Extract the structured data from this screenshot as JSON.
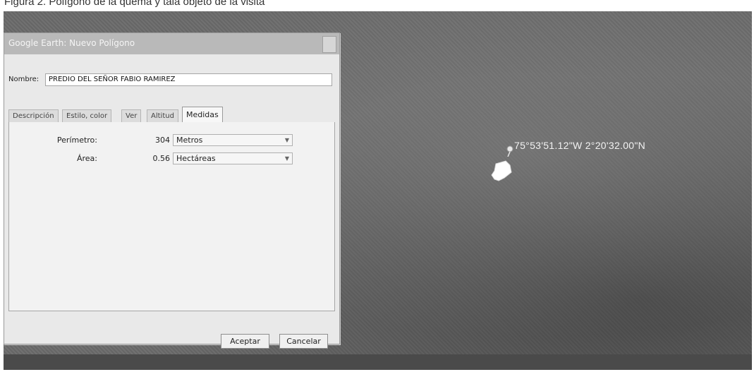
{
  "caption": "Figura 2. Polígono de la quema y tala objeto de la visita",
  "map": {
    "coordinates": "75°53'51.12\"W 2°20'32.00\"N",
    "pin_icon": "pushpin-icon",
    "polygon_icon": "polygon-shape"
  },
  "dialog": {
    "title": "Google Earth: Nuevo Polígono",
    "name_label": "Nombre:",
    "name_value": "PREDIO DEL SEÑOR FABIO RAMIREZ",
    "tabs": [
      {
        "label": "Descripción",
        "active": false
      },
      {
        "label": "Estilo, color",
        "active": false
      },
      {
        "label": "Ver",
        "active": false
      },
      {
        "label": "Altitud",
        "active": false
      },
      {
        "label": "Medidas",
        "active": true
      }
    ],
    "measurements": [
      {
        "label": "Perímetro:",
        "value": "304",
        "unit": "Metros"
      },
      {
        "label": "Área:",
        "value": "0.56",
        "unit": "Hectáreas"
      }
    ],
    "buttons": {
      "accept": "Aceptar",
      "cancel": "Cancelar"
    }
  },
  "colors": {
    "map_background": "#6b6b6b",
    "dialog_background": "#e9e9e9",
    "coords_text": "#f2f2f2"
  }
}
